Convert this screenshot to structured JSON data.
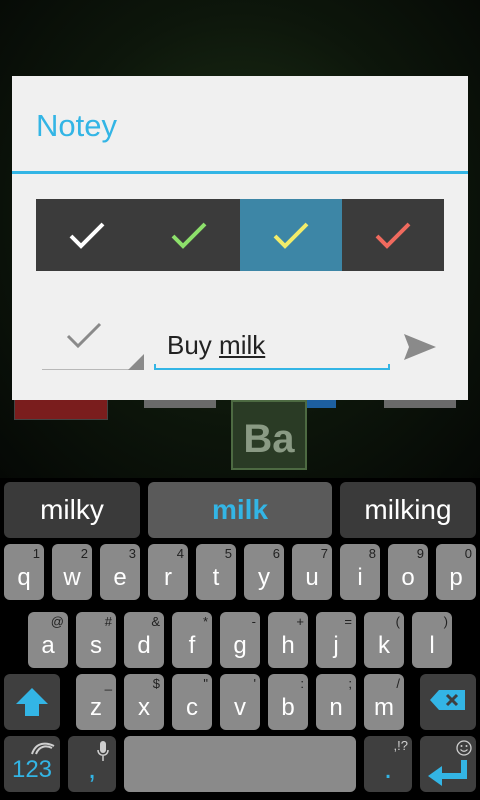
{
  "dialog": {
    "title": "Notey",
    "input_text_prefix": "Buy ",
    "input_text_word": "milk",
    "swatches": [
      {
        "check_color": "#ffffff"
      },
      {
        "check_color": "#8de06b"
      },
      {
        "check_color": "#f2ec6a"
      },
      {
        "check_color": "#f06a5e"
      }
    ],
    "selected_swatch_index": 2
  },
  "background": {
    "tile_label": "Ba"
  },
  "keyboard": {
    "suggestions": [
      "milky",
      "milk",
      "milking"
    ],
    "row1": [
      {
        "main": "q",
        "sub": "1"
      },
      {
        "main": "w",
        "sub": "2"
      },
      {
        "main": "e",
        "sub": "3"
      },
      {
        "main": "r",
        "sub": "4"
      },
      {
        "main": "t",
        "sub": "5"
      },
      {
        "main": "y",
        "sub": "6"
      },
      {
        "main": "u",
        "sub": "7"
      },
      {
        "main": "i",
        "sub": "8"
      },
      {
        "main": "o",
        "sub": "9"
      },
      {
        "main": "p",
        "sub": "0"
      }
    ],
    "row2": [
      {
        "main": "a",
        "sub": "@"
      },
      {
        "main": "s",
        "sub": "#"
      },
      {
        "main": "d",
        "sub": "&"
      },
      {
        "main": "f",
        "sub": "*"
      },
      {
        "main": "g",
        "sub": "-"
      },
      {
        "main": "h",
        "sub": "+"
      },
      {
        "main": "j",
        "sub": "="
      },
      {
        "main": "k",
        "sub": "("
      },
      {
        "main": "l",
        "sub": ")"
      }
    ],
    "row3": [
      {
        "main": "z",
        "sub": "_"
      },
      {
        "main": "x",
        "sub": "$"
      },
      {
        "main": "c",
        "sub": "\""
      },
      {
        "main": "v",
        "sub": "'"
      },
      {
        "main": "b",
        "sub": ":"
      },
      {
        "main": "n",
        "sub": ";"
      },
      {
        "main": "m",
        "sub": "/"
      }
    ],
    "symbols_label": "123",
    "comma_label": ",",
    "period_label": ".",
    "period_sub": ",!?",
    "accent_color": "#33b5e5"
  }
}
